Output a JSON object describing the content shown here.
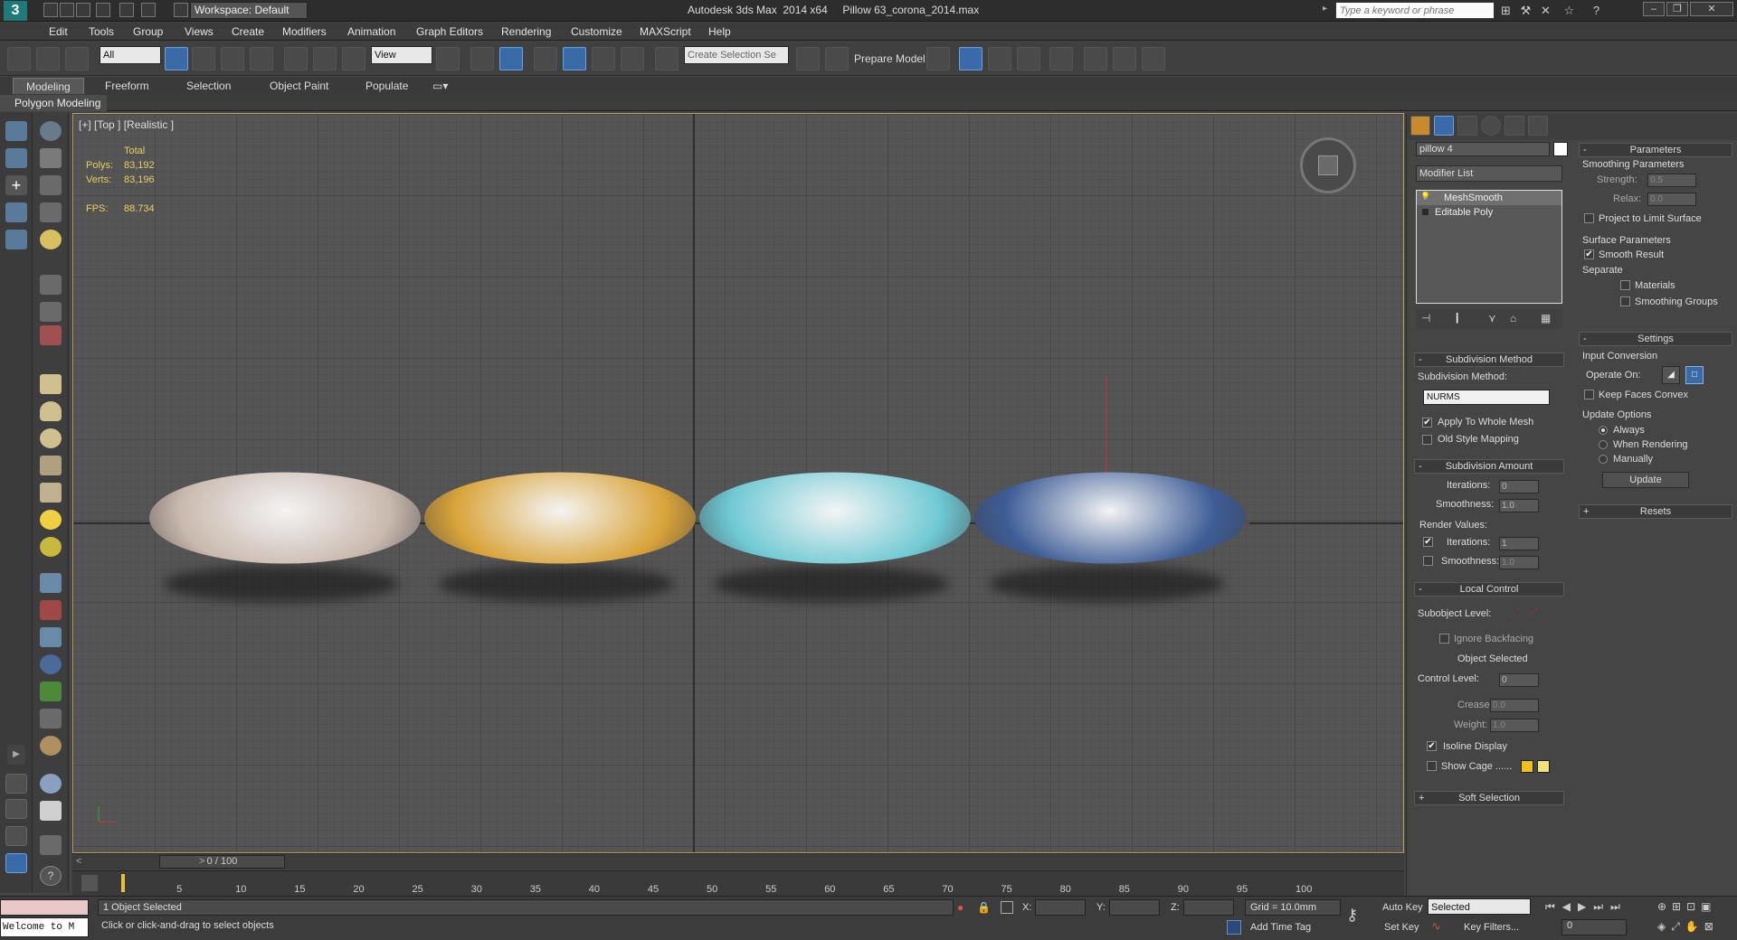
{
  "title_bar": {
    "workspace": "Workspace: Default",
    "app_title": "Autodesk 3ds Max  2014 x64     Pillow 63_corona_2014.max",
    "search_placeholder": "Type a keyword or phrase"
  },
  "menus": [
    "Edit",
    "Tools",
    "Group",
    "Views",
    "Create",
    "Modifiers",
    "Animation",
    "Graph Editors",
    "Rendering",
    "Customize",
    "MAXScript",
    "Help"
  ],
  "toolbar": {
    "selection_filter": "All",
    "reference_coord": "View",
    "prepare_model": "Prepare Model",
    "named_selection": "Create Selection Se"
  },
  "ribbon": {
    "tabs": [
      "Modeling",
      "Freeform",
      "Selection",
      "Object Paint",
      "Populate"
    ],
    "active_tab": "Modeling",
    "sub_label": "Polygon Modeling"
  },
  "viewport": {
    "label": "[+] [Top ] [Realistic ]",
    "stats": {
      "total_label": "Total",
      "polys_label": "Polys:",
      "polys": "83,192",
      "verts_label": "Verts:",
      "verts": "83,196",
      "fps_label": "FPS:",
      "fps": "88.734"
    },
    "pillow_colors": [
      "#c9b9ae",
      "#d9a43a",
      "#6fc9d4",
      "#3e5d96"
    ]
  },
  "timeline": {
    "frame_display": "0 / 100",
    "ticks": [
      "5",
      "10",
      "15",
      "20",
      "25",
      "30",
      "35",
      "40",
      "45",
      "50",
      "55",
      "60",
      "65",
      "70",
      "75",
      "80",
      "85",
      "90",
      "95",
      "100"
    ]
  },
  "status": {
    "maxscript": "Welcome to M",
    "selected": "1 Object Selected",
    "prompt": "Click or click-and-drag to select objects",
    "x_label": "X:",
    "y_label": "Y:",
    "z_label": "Z:",
    "grid": "Grid = 10.0mm",
    "add_time_tag": "Add Time Tag",
    "auto_key": "Auto Key",
    "set_key": "Set Key",
    "key_mode": "Selected",
    "key_filters": "Key Filters...",
    "frame": "0"
  },
  "command_panel": {
    "object_name": "pillow 4",
    "modifier_list": "Modifier List",
    "stack": [
      "MeshSmooth",
      "Editable Poly"
    ],
    "subdivision_method": {
      "header": "Subdivision Method",
      "label": "Subdivision Method:",
      "value": "NURMS",
      "apply_whole_mesh": "Apply To Whole Mesh",
      "old_style": "Old Style Mapping"
    },
    "subdivision_amount": {
      "header": "Subdivision Amount",
      "iterations_label": "Iterations:",
      "iterations": "0",
      "smoothness_label": "Smoothness:",
      "smoothness": "1.0",
      "render_values": "Render Values:",
      "r_iterations_label": "Iterations:",
      "r_iterations": "1",
      "r_smoothness_label": "Smoothness:",
      "r_smoothness": "1.0"
    },
    "local_control": {
      "header": "Local Control",
      "subobject": "Subobject Level:",
      "ignore_backfacing": "Ignore Backfacing",
      "object_selected": "Object Selected",
      "control_level_label": "Control Level:",
      "control_level": "0",
      "crease_label": "Crease:",
      "crease": "0.0",
      "weight_label": "Weight:",
      "weight": "1.0",
      "isoline": "Isoline Display",
      "show_cage": "Show Cage ......",
      "cage_colors": [
        "#f0c020",
        "#f0e080"
      ]
    },
    "soft_selection": "Soft Selection",
    "parameters": {
      "header": "Parameters",
      "smoothing_params": "Smoothing Parameters",
      "strength_label": "Strength:",
      "strength": "0.5",
      "relax_label": "Relax:",
      "relax": "0.0",
      "project_limit": "Project to Limit Surface",
      "surface_params": "Surface Parameters",
      "smooth_result": "Smooth Result",
      "separate": "Separate",
      "materials": "Materials",
      "smoothing_groups": "Smoothing Groups"
    },
    "settings": {
      "header": "Settings",
      "input_conversion": "Input Conversion",
      "operate_on": "Operate On:",
      "keep_convex": "Keep Faces Convex",
      "update_options": "Update Options",
      "always": "Always",
      "when_rendering": "When Rendering",
      "manually": "Manually",
      "update": "Update"
    },
    "resets": "Resets"
  }
}
